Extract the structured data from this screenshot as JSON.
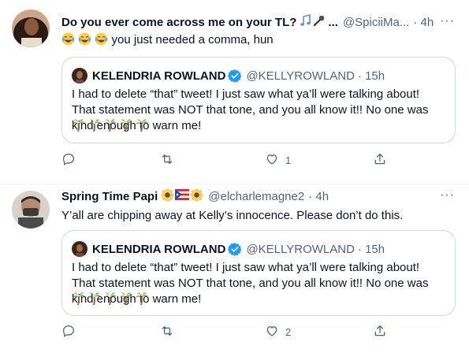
{
  "tweets": [
    {
      "author_name": "Do you ever come across me on your TL?",
      "name_emoji": [
        "musical-notes-emoji",
        "microphone-emoji"
      ],
      "name_suffix": "...",
      "handle": "@SpiciiMa...",
      "time": "· 4h",
      "more_label": "···",
      "text": "you just needed a comma, hun",
      "text_emoji_prefix": [
        "joy-emoji",
        "joy-emoji",
        "joy-emoji"
      ],
      "quote": {
        "name": "KELENDRIA ROWLAND",
        "handle": "@KELLYROWLAND",
        "time": "· 15h",
        "text": "I had to delete “that” tweet! I just saw what ya’ll were talking about! That statement was NOT that tone, and you all know it!! No one was kind enough to warn me!",
        "trailing_emoji": [
          "palm-tree-emoji",
          "palm-tree-emoji",
          "palm-tree-emoji",
          "palm-tree-emoji",
          "palm-tree-emoji"
        ]
      },
      "actions": {
        "reply": "",
        "retweet": "",
        "like": "1",
        "share": ""
      }
    },
    {
      "author_name": "Spring Time Papi",
      "name_emoji": [
        "sunflower-emoji",
        "puerto-rico-flag-emoji",
        "sunflower-emoji"
      ],
      "handle": "@elcharlemagne2",
      "time": "· 4h",
      "more_label": "···",
      "text": "Y’all are chipping away at Kelly’s innocence. Please don’t do this.",
      "quote": {
        "name": "KELENDRIA ROWLAND",
        "handle": "@KELLYROWLAND",
        "time": "· 15h",
        "text": "I had to delete “that” tweet! I just saw what ya’ll were talking about! That statement was NOT that tone, and you all know it!! No one was kind enough to warn me!",
        "trailing_emoji": [
          "palm-tree-emoji",
          "palm-tree-emoji",
          "palm-tree-emoji",
          "palm-tree-emoji",
          "palm-tree-emoji"
        ]
      },
      "actions": {
        "reply": "",
        "retweet": "",
        "like": "2",
        "share": ""
      }
    }
  ],
  "colors": {
    "text_primary": "#0f1419",
    "text_secondary": "#536471",
    "border": "#cfd9de",
    "divider": "#eff3f4",
    "verified_blue": "#1d9bf0"
  }
}
